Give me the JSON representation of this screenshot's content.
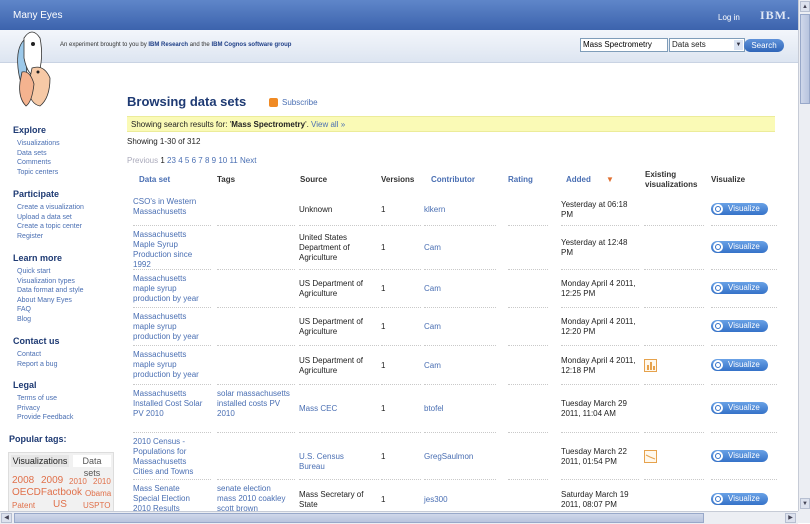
{
  "header": {
    "brand": "Many Eyes",
    "login": "Log in",
    "ibm": "IBM.",
    "tagline_pre": "An experiment brought to you by ",
    "tagline_b1": "IBM Research",
    "tagline_mid": " and the ",
    "tagline_b2": "IBM Cognos software group"
  },
  "search": {
    "value": "Mass Spectrometry",
    "type": "Data sets",
    "button": "Search"
  },
  "sidebar": {
    "explore": {
      "title": "Explore",
      "items": [
        "Visualizations",
        "Data sets",
        "Comments",
        "Topic centers"
      ]
    },
    "participate": {
      "title": "Participate",
      "items": [
        "Create a visualization",
        "Upload a data set",
        "Create a topic center",
        "Register"
      ]
    },
    "learn": {
      "title": "Learn more",
      "items": [
        "Quick start",
        "Visualization types",
        "Data format and style",
        "About Many Eyes",
        "FAQ",
        "Blog"
      ]
    },
    "contact": {
      "title": "Contact us",
      "items": [
        "Contact",
        "Report a bug"
      ]
    },
    "legal": {
      "title": "Legal",
      "items": [
        "Terms of use",
        "Privacy",
        "Provide Feedback"
      ]
    },
    "popular_title": "Popular tags:",
    "tag_tabs": [
      "Visualizations",
      "Data sets"
    ],
    "tags": [
      "2008",
      "2009",
      "2010",
      "2010",
      "OECDFactbook",
      "Obama",
      "Patent",
      "US",
      "USPTO"
    ]
  },
  "main": {
    "title": "Browsing data sets",
    "subscribe": "Subscribe",
    "notice_pre": "Showing search results for: '",
    "notice_query": "Mass Spectrometry",
    "notice_post": "'.",
    "notice_link": "View all »",
    "showing": "Showing 1-30 of 312",
    "pager": {
      "prev": "Previous",
      "current": "1",
      "pages": [
        "2",
        "3",
        "4",
        "5",
        "6",
        "7",
        "8",
        "9",
        "10",
        "11"
      ],
      "next": "Next"
    }
  },
  "table": {
    "headers": {
      "dataset": "Data set",
      "tags": "Tags",
      "source": "Source",
      "versions": "Versions",
      "contributor": "Contributor",
      "rating": "Rating",
      "added": "Added",
      "sort_arrow": "▼",
      "existing": "Existing visualizations",
      "visualize": "Visualize"
    },
    "visualize_label": "Visualize",
    "rows": [
      {
        "dataset": "CSO's in Western Massachusetts",
        "tags": "",
        "source": "Unknown",
        "versions": "1",
        "contributor": "klkern",
        "added": "Yesterday at 06:18 PM"
      },
      {
        "dataset": "Massachusetts Maple Syrup Production since 1992",
        "tags": "",
        "source": "United States Department of Agriculture",
        "versions": "1",
        "contributor": "Cam",
        "added": "Yesterday at 12:48 PM"
      },
      {
        "dataset": "Massachusetts maple syrup production by year",
        "tags": "",
        "source": "US Department of Agriculture",
        "versions": "1",
        "contributor": "Cam",
        "added": "Monday April 4 2011, 12:25 PM"
      },
      {
        "dataset": "Massachusetts maple syrup production by year",
        "tags": "",
        "source": "US Department of Agriculture",
        "versions": "1",
        "contributor": "Cam",
        "added": "Monday April 4 2011, 12:20 PM"
      },
      {
        "dataset": "Massachusetts maple syrup production by year",
        "tags": "",
        "source": "US Department of Agriculture",
        "versions": "1",
        "contributor": "Cam",
        "added": "Monday April 4 2011, 12:18 PM",
        "existing": "bar-chart-icon"
      },
      {
        "dataset": "Massachusetts Installed Cost Solar PV 2010",
        "tags": "solar massachusetts installed costs PV 2010",
        "source": "Mass CEC",
        "versions": "1",
        "contributor": "btofel",
        "added": "Tuesday March 29 2011, 11:04 AM"
      },
      {
        "dataset": "2010 Census - Populations for Massachusetts Cities and Towns",
        "tags": "",
        "source": "U.S. Census Bureau",
        "versions": "1",
        "contributor": "GregSaulmon",
        "added": "Tuesday March 22 2011, 01:54 PM",
        "existing": "line-chart-icon"
      },
      {
        "dataset": "Mass Senate Special Election 2010 Results",
        "tags": "senate election mass 2010 coakley scott brown",
        "source": "Mass Secretary of State",
        "versions": "1",
        "contributor": "jes300",
        "added": "Saturday March 19 2011, 08:07 PM"
      }
    ]
  }
}
